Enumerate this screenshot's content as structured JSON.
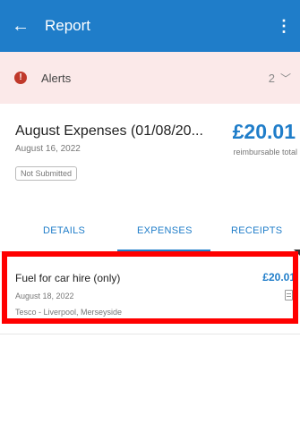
{
  "appbar": {
    "back_icon": "arrow-left-icon",
    "title": "Report",
    "menu_icon": "more-vert-icon"
  },
  "alerts": {
    "label": "Alerts",
    "count": "2",
    "icon": "alert-circle-icon",
    "chevron_icon": "chevron-down-icon",
    "icon_color": "#c0392b"
  },
  "report": {
    "name": "August Expenses (01/08/20...",
    "date": "August 16, 2022",
    "status": "Not Submitted",
    "total": "£20.01",
    "total_label": "reimbursable total"
  },
  "tabs": {
    "details": "DETAILS",
    "expenses": "EXPENSES",
    "receipts": "RECEIPTS",
    "active": "EXPENSES"
  },
  "expense": {
    "title": "Fuel for car hire (only)",
    "date": "August 18, 2022",
    "merchant": "Tesco - Liverpool, Merseyside",
    "amount": "£20.01",
    "receipt_icon": "receipt-icon"
  },
  "colors": {
    "accent": "#1f7dc9",
    "alert_bg": "#fbe9e9",
    "highlight": "#ff0000"
  }
}
